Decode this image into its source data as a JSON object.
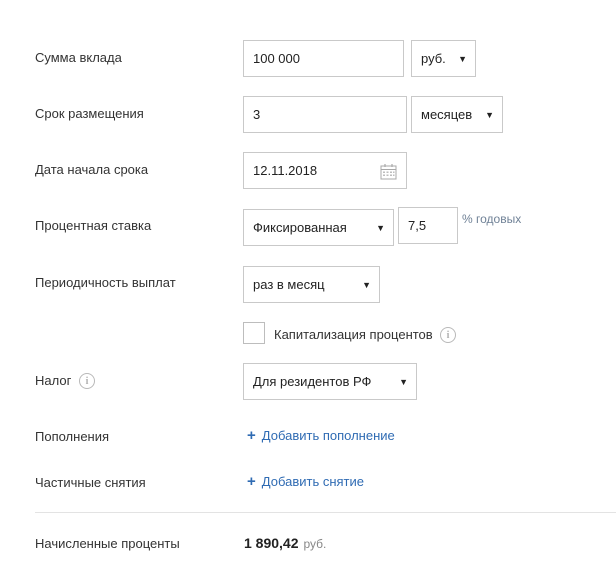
{
  "form": {
    "amount": {
      "label": "Сумма вклада",
      "value": "100 000",
      "currency": "руб."
    },
    "term": {
      "label": "Срок размещения",
      "value": "3",
      "unit": "месяцев"
    },
    "start_date": {
      "label": "Дата начала срока",
      "value": "12.11.2018"
    },
    "rate": {
      "label": "Процентная ставка",
      "type": "Фиксированная",
      "value": "7,5",
      "suffix": "% годовых"
    },
    "payout": {
      "label": "Периодичность выплат",
      "value": "раз в месяц"
    },
    "capitalization": {
      "label": "Капитализация процентов",
      "checked": false
    },
    "tax": {
      "label": "Налог",
      "value": "Для резидентов РФ"
    },
    "topups": {
      "label": "Пополнения",
      "link": "Добавить пополнение"
    },
    "withdrawals": {
      "label": "Частичные снятия",
      "link": "Добавить снятие"
    }
  },
  "result": {
    "label": "Начисленные проценты",
    "value": "1 890,42",
    "currency": "руб."
  },
  "icons": {
    "dropdown": "triangle-down",
    "calendar": "calendar-icon",
    "info": "info-icon",
    "add": "plus-icon"
  },
  "colors": {
    "link": "#2f6bb3",
    "border": "#c9c9c9",
    "muted": "#888888"
  }
}
